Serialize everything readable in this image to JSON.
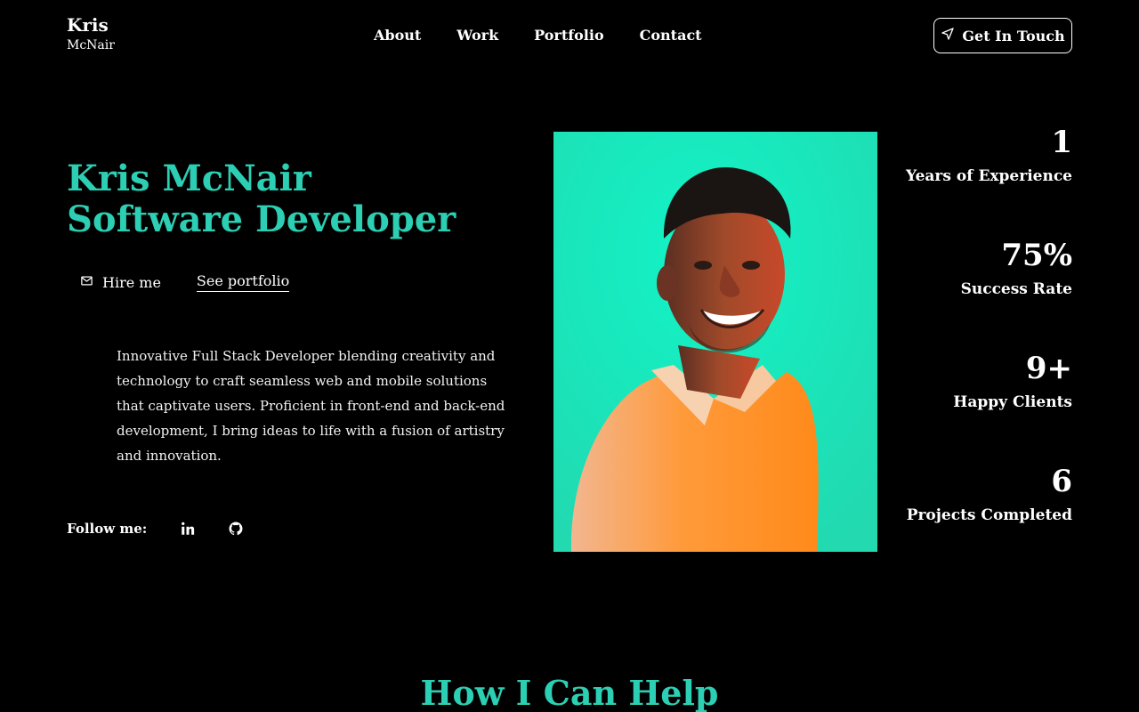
{
  "logo": {
    "first": "Kris",
    "last": "McNair"
  },
  "nav": [
    {
      "label": "About"
    },
    {
      "label": "Work"
    },
    {
      "label": "Portfolio"
    },
    {
      "label": "Contact"
    }
  ],
  "cta": {
    "label": "Get In Touch",
    "icon": "send-icon"
  },
  "hero": {
    "name": "Kris McNair",
    "role": "Software Developer",
    "hire_label": "Hire me",
    "portfolio_label": "See portfolio",
    "bio": "Innovative Full Stack Developer blending creativity and technology to craft seamless web and mobile solutions that captivate users. Proficient in front-end and back-end development, I bring ideas to life with a fusion of artistry and innovation."
  },
  "follow": {
    "label": "Follow me:",
    "icons": [
      "linkedin-icon",
      "github-icon"
    ]
  },
  "stats": [
    {
      "value": "1",
      "label": "Years of Experience"
    },
    {
      "value": "75%",
      "label": "Success Rate"
    },
    {
      "value": "9+",
      "label": "Happy Clients"
    },
    {
      "value": "6",
      "label": "Projects Completed"
    }
  ],
  "section": {
    "title": "How I Can Help"
  },
  "colors": {
    "accent": "#2ccfb3",
    "background": "#000000",
    "text": "#ffffff",
    "photo_bg": "#19f0c0"
  }
}
